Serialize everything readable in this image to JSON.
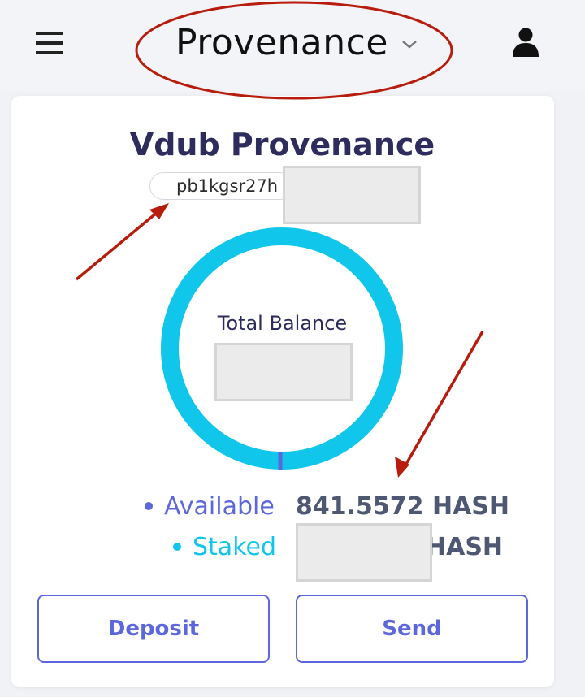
{
  "header": {
    "network_name": "Provenance",
    "menu_icon": "hamburger-menu-icon",
    "dropdown_icon": "chevron-down-icon",
    "account_icon": "user-icon"
  },
  "wallet": {
    "name": "Vdub Provenance",
    "address_visible": "pb1kgsr27h"
  },
  "balance": {
    "total_label": "Total Balance",
    "available_fraction": 0.005,
    "staked_fraction": 0.995
  },
  "legend": {
    "available_label": "Available",
    "available_value": "841.5572 HASH",
    "staked_label": "Staked",
    "staked_unit": "HASH"
  },
  "actions": {
    "deposit_label": "Deposit",
    "send_label": "Send"
  },
  "colors": {
    "staked": "#10c6ea",
    "available": "#5c67dc",
    "annotation": "#b71c0c"
  }
}
